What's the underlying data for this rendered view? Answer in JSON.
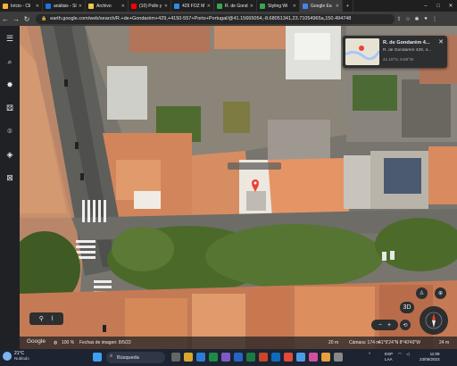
{
  "browser": {
    "tabs": [
      {
        "label": "Início - Cli",
        "color": "#f3b43c",
        "active": false
      },
      {
        "label": "análisis - Sl",
        "color": "#1a73e8",
        "active": false
      },
      {
        "label": "Archivo",
        "color": "#f4c542",
        "active": false
      },
      {
        "label": "(10) Pollo y",
        "color": "#ff0000",
        "active": false
      },
      {
        "label": "429 FOZ M",
        "color": "#2f8be6",
        "active": false
      },
      {
        "label": "R. de Gond",
        "color": "#34a853",
        "active": false
      },
      {
        "label": "Styling Wi",
        "color": "#34a853",
        "active": false
      },
      {
        "label": "Google Ea",
        "color": "#4285f4",
        "active": true
      }
    ],
    "url": "earth.google.com/web/search/R.+de+Gondarém+429,+4150-557+Porto+Portugal/@41.15665054,-8.68051341,23.71054965a,150.494748"
  },
  "card": {
    "title": "R. de Gondarém 4...",
    "address": "R. de Gondarém 429, 4...",
    "coords": "41.16°N, 8.68°W",
    "thumb_label": "R. de Gondarém 4"
  },
  "controls": {
    "mode_3d": "3D"
  },
  "status": {
    "brand": "Google",
    "percent": "100 %",
    "imagery_date": "Fechas de imagen: 8/5/22",
    "scale": "20 m",
    "camera": "Cámara: 174 m",
    "coordinates": "41°9'24\"N 8°40'49\"W",
    "altitude": "24 m"
  },
  "taskbar": {
    "temperature": "21°C",
    "weather": "Nublado",
    "search_placeholder": "Búsqueda",
    "lang": "ESP",
    "layout": "LAA",
    "time": "11:09",
    "date": "23/08/2023"
  }
}
